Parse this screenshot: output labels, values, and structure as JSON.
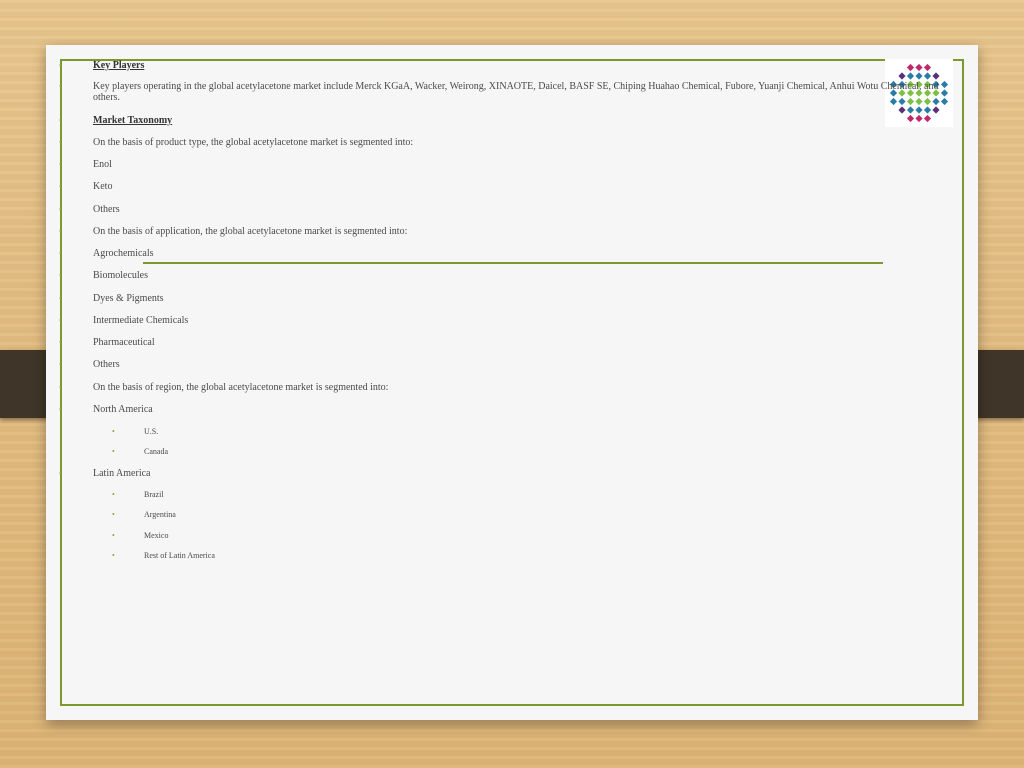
{
  "slide": {
    "items": [
      {
        "level": 1,
        "heading": true,
        "text": "Key Players"
      },
      {
        "level": 1,
        "heading": false,
        "text": "Key players operating in the global acetylacetone market include Merck KGaA, Wacker, Weirong, XINAOTE, Daicel, BASF SE, Chiping Huahao Chemical, Fubore, Yuanji Chemical, Anhui Wotu Chemical, and others."
      },
      {
        "level": 1,
        "heading": true,
        "text": "Market Taxonomy"
      },
      {
        "level": 1,
        "heading": false,
        "text": "On the basis of product type, the global acetylacetone market is segmented into:"
      },
      {
        "level": 1,
        "heading": false,
        "text": "Enol"
      },
      {
        "level": 1,
        "heading": false,
        "text": "Keto"
      },
      {
        "level": 1,
        "heading": false,
        "text": "Others"
      },
      {
        "level": 1,
        "heading": false,
        "text": "On the basis of application, the global acetylacetone market is segmented into:"
      },
      {
        "level": 1,
        "heading": false,
        "text": "Agrochemicals"
      },
      {
        "level": 1,
        "heading": false,
        "text": "Biomolecules"
      },
      {
        "level": 1,
        "heading": false,
        "text": "Dyes & Pigments"
      },
      {
        "level": 1,
        "heading": false,
        "text": "Intermediate Chemicals"
      },
      {
        "level": 1,
        "heading": false,
        "text": "Pharmaceutical"
      },
      {
        "level": 1,
        "heading": false,
        "text": "Others"
      },
      {
        "level": 1,
        "heading": false,
        "text": "On the basis of region, the global acetylacetone market is segmented into:"
      },
      {
        "level": 1,
        "heading": false,
        "text": "North America"
      },
      {
        "level": 2,
        "heading": false,
        "text": "U.S."
      },
      {
        "level": 2,
        "heading": false,
        "text": "Canada"
      },
      {
        "level": 1,
        "heading": false,
        "text": "Latin America"
      },
      {
        "level": 2,
        "heading": false,
        "text": "Brazil"
      },
      {
        "level": 2,
        "heading": false,
        "text": "Argentina"
      },
      {
        "level": 2,
        "heading": false,
        "text": "Mexico"
      },
      {
        "level": 2,
        "heading": false,
        "text": "Rest of Latin America"
      }
    ],
    "bullet_glyph": "•",
    "colors": {
      "accent": "#7a9a2e",
      "bullet": "#8aa43a",
      "background": "#f6f6f6",
      "text": "#4a4a4a"
    }
  },
  "logo": {
    "icon": "company-logo-icon",
    "colors": [
      "#c0286b",
      "#2a7ca8",
      "#7cc142",
      "#5b2d7a"
    ]
  }
}
